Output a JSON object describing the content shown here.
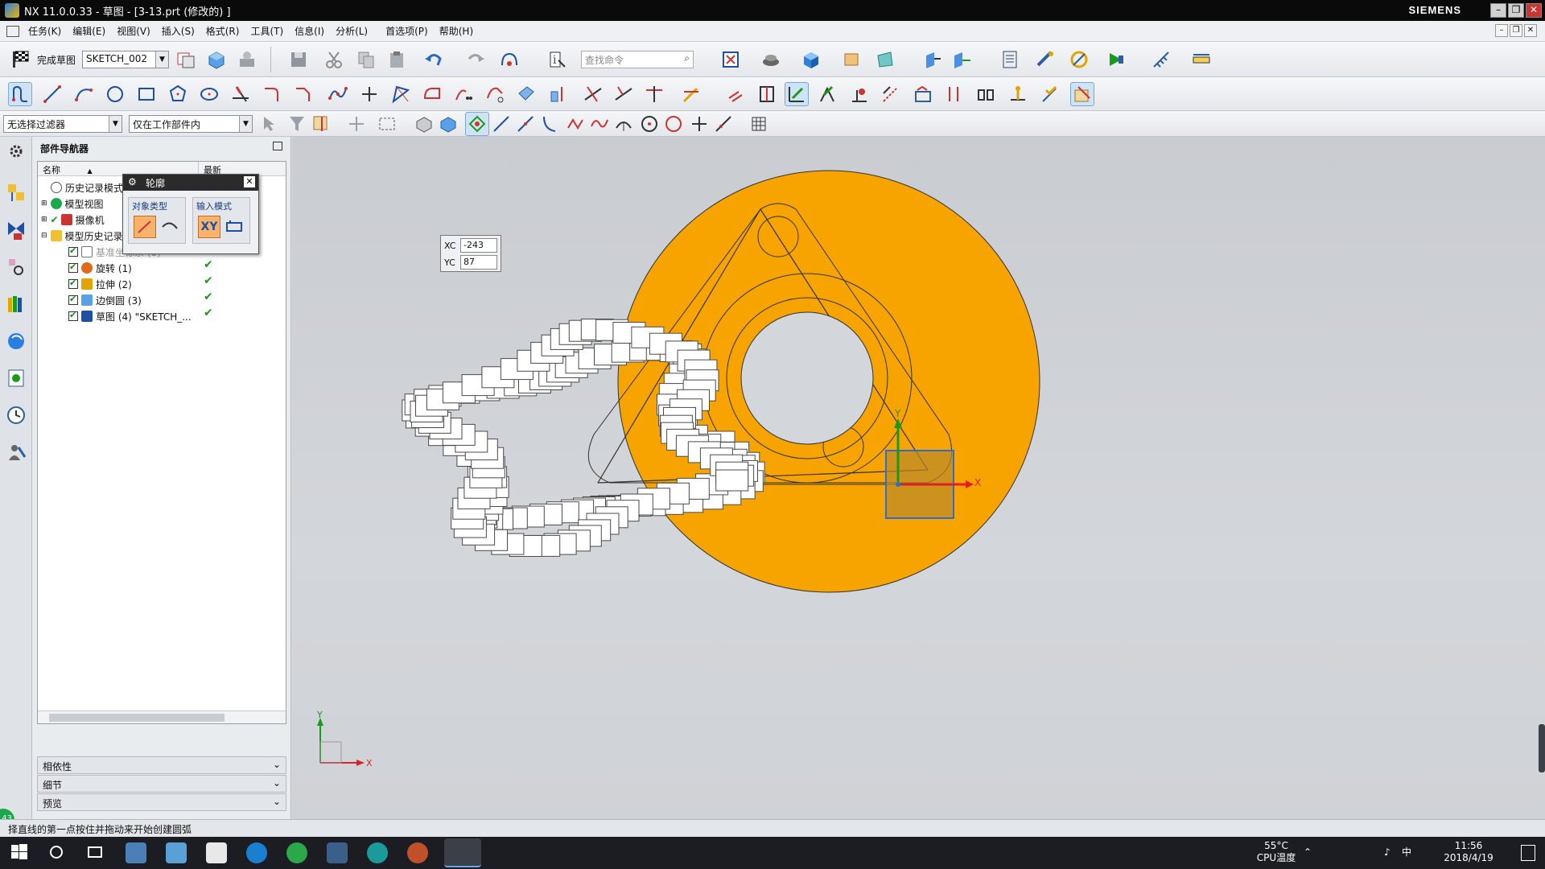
{
  "window": {
    "title": "NX 11.0.0.33 - 草图 - [3-13.prt  (修改的) ]",
    "brand": "SIEMENS"
  },
  "menu": [
    "任务(K)",
    "编辑(E)",
    "视图(V)",
    "插入(S)",
    "格式(R)",
    "工具(T)",
    "信息(I)",
    "分析(L)",
    "首选项(P)",
    "帮助(H)"
  ],
  "toolbar1": {
    "finish_sketch_label": "完成草图",
    "sketch_name": "SKETCH_002",
    "search_placeholder": "查找命令"
  },
  "toolbar3": {
    "selection_filter": "无选择过滤器",
    "scope": "仅在工作部件内"
  },
  "navigator": {
    "title": "部件导航器",
    "col_name": "名称",
    "col_latest": "最新",
    "items": [
      {
        "label": "历史记录模式"
      },
      {
        "label": "模型视图"
      },
      {
        "label": "摄像机"
      },
      {
        "label": "模型历史记录"
      },
      {
        "label": "基准坐标系 (0)"
      },
      {
        "label": "旋转 (1)"
      },
      {
        "label": "拉伸 (2)"
      },
      {
        "label": "边倒圆 (3)"
      },
      {
        "label": "草图 (4) \"SKETCH_..."
      }
    ],
    "panels": [
      "相依性",
      "细节",
      "预览"
    ]
  },
  "profile_dialog": {
    "title": "轮廓",
    "object_type_label": "对象类型",
    "input_mode_label": "输入模式",
    "xy_label": "XY"
  },
  "coord_input": {
    "xc_label": "XC",
    "yc_label": "YC",
    "xc_value": "-243",
    "yc_value": "87"
  },
  "graphics": {
    "part_color": "#f7a300",
    "axis_x_label": "X",
    "axis_y_label": "Y",
    "triad_x_label": "X",
    "triad_y_label": "Y"
  },
  "status": {
    "prompt": "择直线的第一点按住并拖动来开始创建圆弧"
  },
  "taskbar": {
    "temp": "55°C",
    "temp_label": "CPU温度",
    "ime": "中",
    "time": "11:56",
    "date": "2018/4/19"
  }
}
